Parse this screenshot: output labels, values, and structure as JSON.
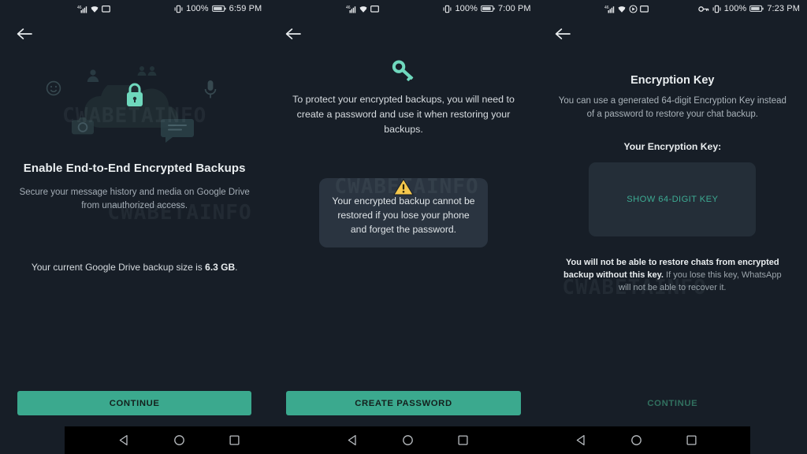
{
  "theme": {
    "background": "#171e27",
    "accent_teal": "#3ba98e",
    "key_teal": "#3dab93",
    "warn_amber": "#f5c84c",
    "card_bg": "#2a3440",
    "keybox_bg": "#242e38",
    "navbar_bg": "#000000",
    "text_primary": "#e9edef",
    "text_secondary": "#a4adb6"
  },
  "watermark": "CWABETAINFO",
  "panels": [
    {
      "status": {
        "time": "6:59 PM",
        "battery": "100%",
        "icons": [
          "signal-icon",
          "wifi-icon",
          "cast-icon"
        ],
        "right_icons": [
          "vibrate-icon",
          "battery-icon"
        ]
      },
      "back_label": "Back",
      "illustration_icons": [
        "emoji-icon",
        "person-icon",
        "group-icon",
        "cloud-icon",
        "lock-icon",
        "microphone-icon",
        "camera-icon",
        "chat-bubble-icon"
      ],
      "title": "Enable End-to-End Encrypted Backups",
      "subtitle": "Secure your message history and media on Google Drive from unauthorized access.",
      "footnote_prefix": "Your current Google Drive backup size is ",
      "footnote_value": "6.3 GB",
      "footnote_suffix": ".",
      "button_label": "CONTINUE",
      "button_state": "enabled"
    },
    {
      "status": {
        "time": "7:00 PM",
        "battery": "100%",
        "icons": [
          "signal-icon",
          "wifi-icon",
          "cast-icon"
        ],
        "right_icons": [
          "vibrate-icon",
          "battery-icon"
        ]
      },
      "back_label": "Back",
      "hero_icon": "key-icon",
      "body": "To protect your encrypted backups, you will need to create a password and use it when restoring your backups.",
      "warning_icon": "warning-triangle-icon",
      "warning_text": "Your encrypted backup cannot be restored if you lose your phone and forget the password.",
      "button_label": "CREATE PASSWORD",
      "button_state": "enabled"
    },
    {
      "status": {
        "time": "7:23 PM",
        "battery": "100%",
        "icons": [
          "signal-icon",
          "wifi-icon",
          "record-icon",
          "cast-icon"
        ],
        "right_icons": [
          "key-status-icon",
          "vibrate-icon",
          "battery-icon"
        ]
      },
      "back_label": "Back",
      "title": "Encryption Key",
      "subtitle": "You can use a generated 64-digit Encryption Key instead of a password to restore your chat backup.",
      "section_label": "Your Encryption Key:",
      "show_key_button": "SHOW 64-DIGIT KEY",
      "warning_bold": "You will not be able to restore chats from encrypted backup without this key.",
      "warning_rest": " If you lose this key, WhatsApp will not be able to recover it.",
      "button_label": "CONTINUE",
      "button_state": "disabled"
    }
  ],
  "navbar": {
    "buttons": [
      "back-nav-icon",
      "home-nav-icon",
      "recents-nav-icon"
    ]
  }
}
